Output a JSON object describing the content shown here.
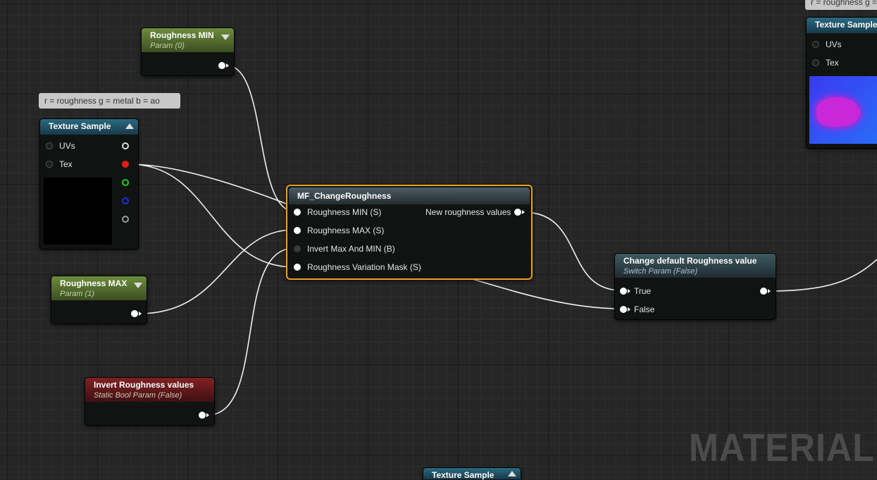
{
  "comments": {
    "texture_sample": "r = roughness g = metal b = ao",
    "top_right": "r = roughness g ="
  },
  "roughness_min": {
    "title": "Roughness MIN",
    "subtitle": "Param (0)"
  },
  "roughness_max": {
    "title": "Roughness MAX",
    "subtitle": "Param (1)"
  },
  "invert_roughness": {
    "title": "Invert Roughness values",
    "subtitle": "Static Bool Param (False)"
  },
  "texture_sample_left": {
    "title": "Texture Sample",
    "inputs": [
      "UVs",
      "Tex"
    ]
  },
  "texture_sample_right": {
    "title": "Texture Sample",
    "inputs": [
      "UVs",
      "Tex"
    ]
  },
  "texture_sample_bottom": {
    "title": "Texture Sample"
  },
  "mf_change_roughness": {
    "title": "MF_ChangeRoughness",
    "inputs": [
      "Roughness MIN (S)",
      "Roughness MAX (S)",
      "Invert Max And MIN (B)",
      "Roughness Variation Mask (S)"
    ],
    "output": "New roughness values"
  },
  "switch_node": {
    "title": "Change default Roughness value",
    "subtitle": "Switch Param (False)",
    "inputs": [
      "True",
      "False"
    ]
  },
  "watermark": "MATERIAL",
  "colors": {
    "selected_outline": "#f0a020",
    "param_header": "#6d8d3b",
    "texture_header": "#296a81",
    "bool_header": "#822022"
  }
}
